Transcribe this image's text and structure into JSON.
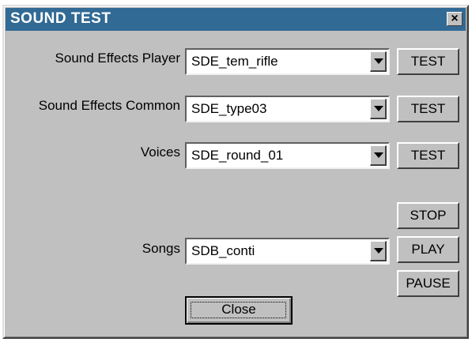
{
  "window": {
    "title": "SOUND TEST",
    "close_glyph": "×"
  },
  "rows": {
    "sound_effects_player": {
      "label": "Sound Effects Player",
      "value": "SDE_tem_rifle",
      "button": "TEST"
    },
    "sound_effects_common": {
      "label": "Sound Effects Common",
      "value": "SDE_type03",
      "button": "TEST"
    },
    "voices": {
      "label": "Voices",
      "value": "SDE_round_01",
      "button": "TEST"
    },
    "songs": {
      "label": "Songs",
      "value": "SDB_conti"
    }
  },
  "song_controls": {
    "stop": "STOP",
    "play": "PLAY",
    "pause": "PAUSE"
  },
  "footer": {
    "close_label": "Close"
  },
  "colors": {
    "titlebar": "#316a94",
    "dialog_face": "#c0c0c0"
  },
  "icons": {
    "close": "close-icon",
    "dropdown": "chevron-down-icon"
  }
}
